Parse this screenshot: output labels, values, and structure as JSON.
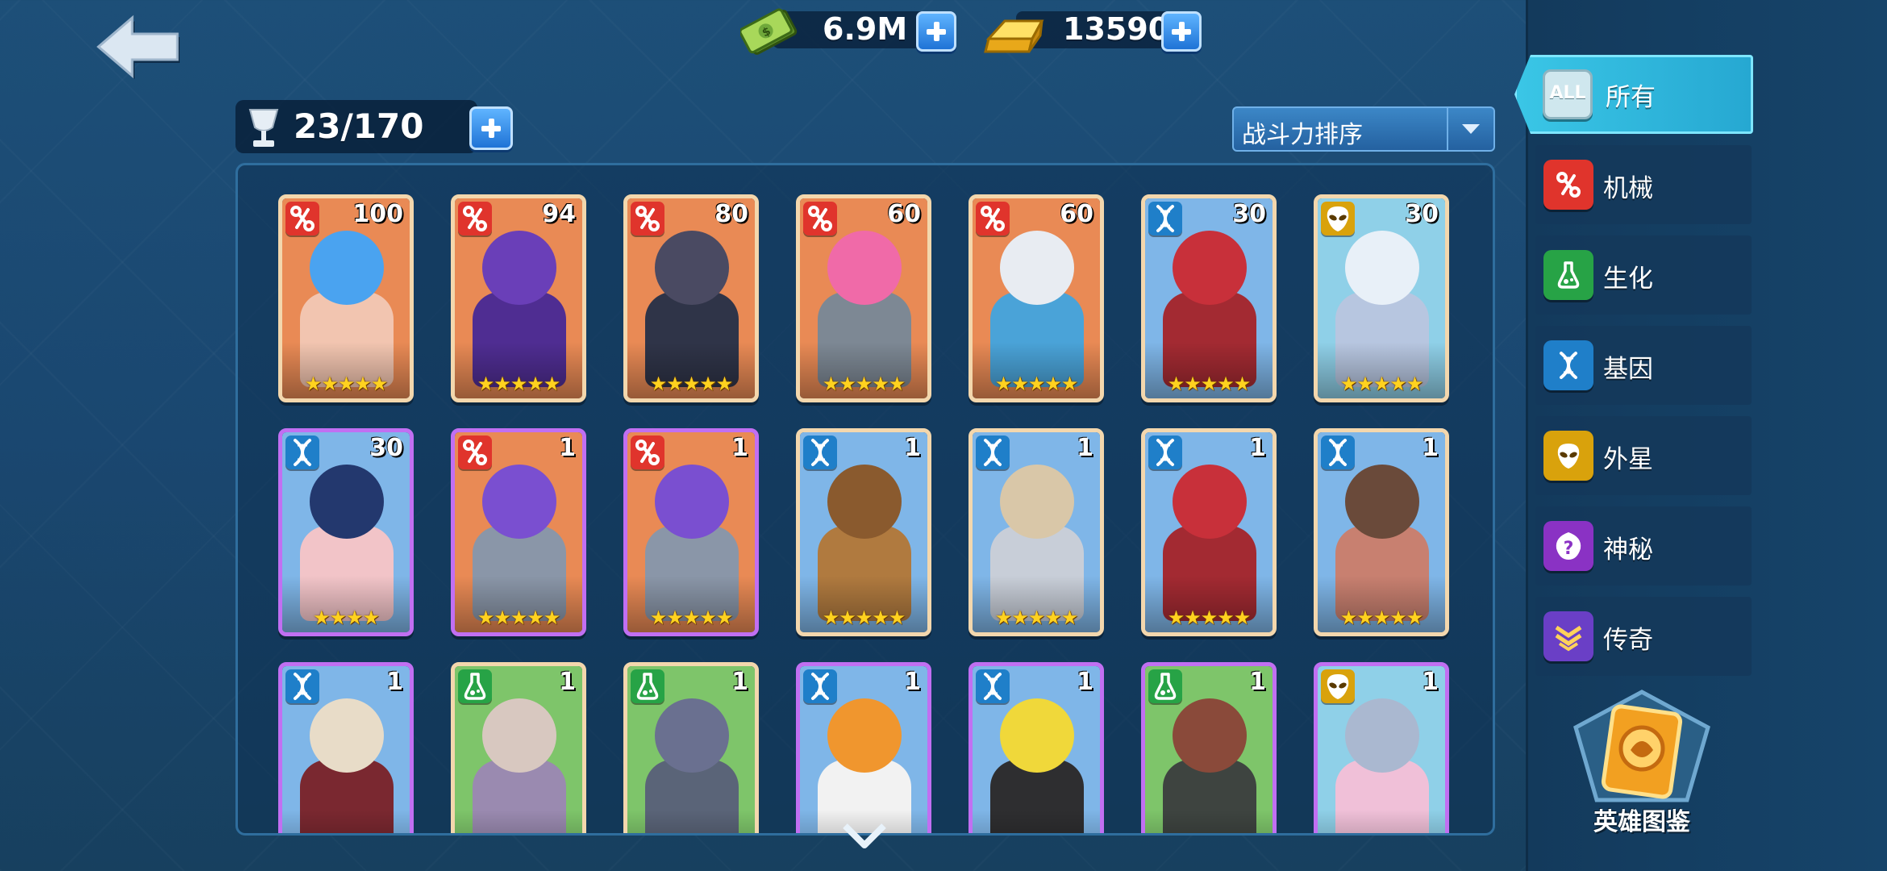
{
  "header": {
    "cash": {
      "icon": "cash-icon",
      "value": "6.9M"
    },
    "gold": {
      "icon": "gold-bar-icon",
      "value": "13590"
    },
    "capacity": {
      "icon": "trophy-cup-icon",
      "value": "23/170"
    }
  },
  "sort": {
    "selected": "战斗力排序"
  },
  "cards": [
    {
      "faction": "mech",
      "level": "100",
      "stars": 5,
      "bg": "#e98a55",
      "head": "#4aa3f0",
      "body": "#f2c5b0",
      "rarity": "gold"
    },
    {
      "faction": "mech",
      "level": "94",
      "stars": 5,
      "bg": "#e98a55",
      "head": "#6a3fb8",
      "body": "#4f2d92",
      "rarity": "gold"
    },
    {
      "faction": "mech",
      "level": "80",
      "stars": 5,
      "bg": "#e98a55",
      "head": "#4a4a62",
      "body": "#2f3448",
      "rarity": "gold"
    },
    {
      "faction": "mech",
      "level": "60",
      "stars": 5,
      "bg": "#e98a55",
      "head": "#f06aa8",
      "body": "#7d8894",
      "rarity": "gold"
    },
    {
      "faction": "mech",
      "level": "60",
      "stars": 5,
      "bg": "#e98a55",
      "head": "#e8ecf2",
      "body": "#4aa3d8",
      "rarity": "gold"
    },
    {
      "faction": "gene",
      "level": "30",
      "stars": 5,
      "bg": "#7fb6e8",
      "head": "#c8303a",
      "body": "#a32a32",
      "rarity": "gold"
    },
    {
      "faction": "alien",
      "level": "30",
      "stars": 5,
      "bg": "#8fd0e8",
      "head": "#e8f0f8",
      "body": "#b7c6e0",
      "rarity": "gold"
    },
    {
      "faction": "gene",
      "level": "30",
      "stars": 4,
      "bg": "#7fb6e8",
      "head": "#23386e",
      "body": "#f2c4c8",
      "rarity": "purple"
    },
    {
      "faction": "mech",
      "level": "1",
      "stars": 5,
      "bg": "#e98a55",
      "head": "#7a4fd0",
      "body": "#8a96a8",
      "rarity": "purple"
    },
    {
      "faction": "mech",
      "level": "1",
      "stars": 5,
      "bg": "#e98a55",
      "head": "#7a4fd0",
      "body": "#8a96a8",
      "rarity": "purple"
    },
    {
      "faction": "gene",
      "level": "1",
      "stars": 5,
      "bg": "#7fb6e8",
      "head": "#8a5a2e",
      "body": "#b07a3f",
      "rarity": "gold"
    },
    {
      "faction": "gene",
      "level": "1",
      "stars": 5,
      "bg": "#7fb6e8",
      "head": "#d9c7a8",
      "body": "#c8ced8",
      "rarity": "gold"
    },
    {
      "faction": "gene",
      "level": "1",
      "stars": 5,
      "bg": "#7fb6e8",
      "head": "#c8303a",
      "body": "#a32a32",
      "rarity": "gold"
    },
    {
      "faction": "gene",
      "level": "1",
      "stars": 5,
      "bg": "#7fb6e8",
      "head": "#6a4a3a",
      "body": "#c88070",
      "rarity": "gold"
    },
    {
      "faction": "gene",
      "level": "1",
      "stars": 0,
      "bg": "#7fb6e8",
      "head": "#e8dcc8",
      "body": "#7a2830",
      "rarity": "purple"
    },
    {
      "faction": "bio",
      "level": "1",
      "stars": 0,
      "bg": "#7ec56a",
      "head": "#d8c8c0",
      "body": "#9a8ab0",
      "rarity": "gold"
    },
    {
      "faction": "bio",
      "level": "1",
      "stars": 0,
      "bg": "#7ec56a",
      "head": "#6a7090",
      "body": "#5a6478",
      "rarity": "gold"
    },
    {
      "faction": "gene",
      "level": "1",
      "stars": 0,
      "bg": "#7fb6e8",
      "head": "#f0962e",
      "body": "#f2f2f2",
      "rarity": "purple"
    },
    {
      "faction": "gene",
      "level": "1",
      "stars": 0,
      "bg": "#7fb6e8",
      "head": "#f0d83a",
      "body": "#2e2e30",
      "rarity": "purple"
    },
    {
      "faction": "bio",
      "level": "1",
      "stars": 0,
      "bg": "#7ec56a",
      "head": "#8a4a3a",
      "body": "#3e4440",
      "rarity": "purple"
    },
    {
      "faction": "alien",
      "level": "1",
      "stars": 0,
      "bg": "#8fd0e8",
      "head": "#aab8d0",
      "body": "#f0c0d8",
      "rarity": "purple"
    }
  ],
  "filters": [
    {
      "key": "all",
      "label": "所有",
      "icon": "all-icon",
      "active": true
    },
    {
      "key": "mech",
      "label": "机械",
      "icon": "mech-icon",
      "active": false
    },
    {
      "key": "bio",
      "label": "生化",
      "icon": "flask-icon",
      "active": false
    },
    {
      "key": "gene",
      "label": "基因",
      "icon": "dna-icon",
      "active": false
    },
    {
      "key": "alien",
      "label": "外星",
      "icon": "alien-icon",
      "active": false
    },
    {
      "key": "mystic",
      "label": "神秘",
      "icon": "mystery-icon",
      "active": false
    },
    {
      "key": "legend",
      "label": "传奇",
      "icon": "legend-chevron-icon",
      "active": false
    }
  ],
  "filter_all_text": "ALL",
  "codex": {
    "label": "英雄图鉴",
    "icon": "hero-codex-icon"
  },
  "colors": {
    "mech": "#e0342c",
    "bio": "#27a346",
    "gene": "#1f7fc9",
    "alien": "#d9a20c",
    "mystic": "#8a32c4",
    "legend": "#6a3fc6"
  }
}
